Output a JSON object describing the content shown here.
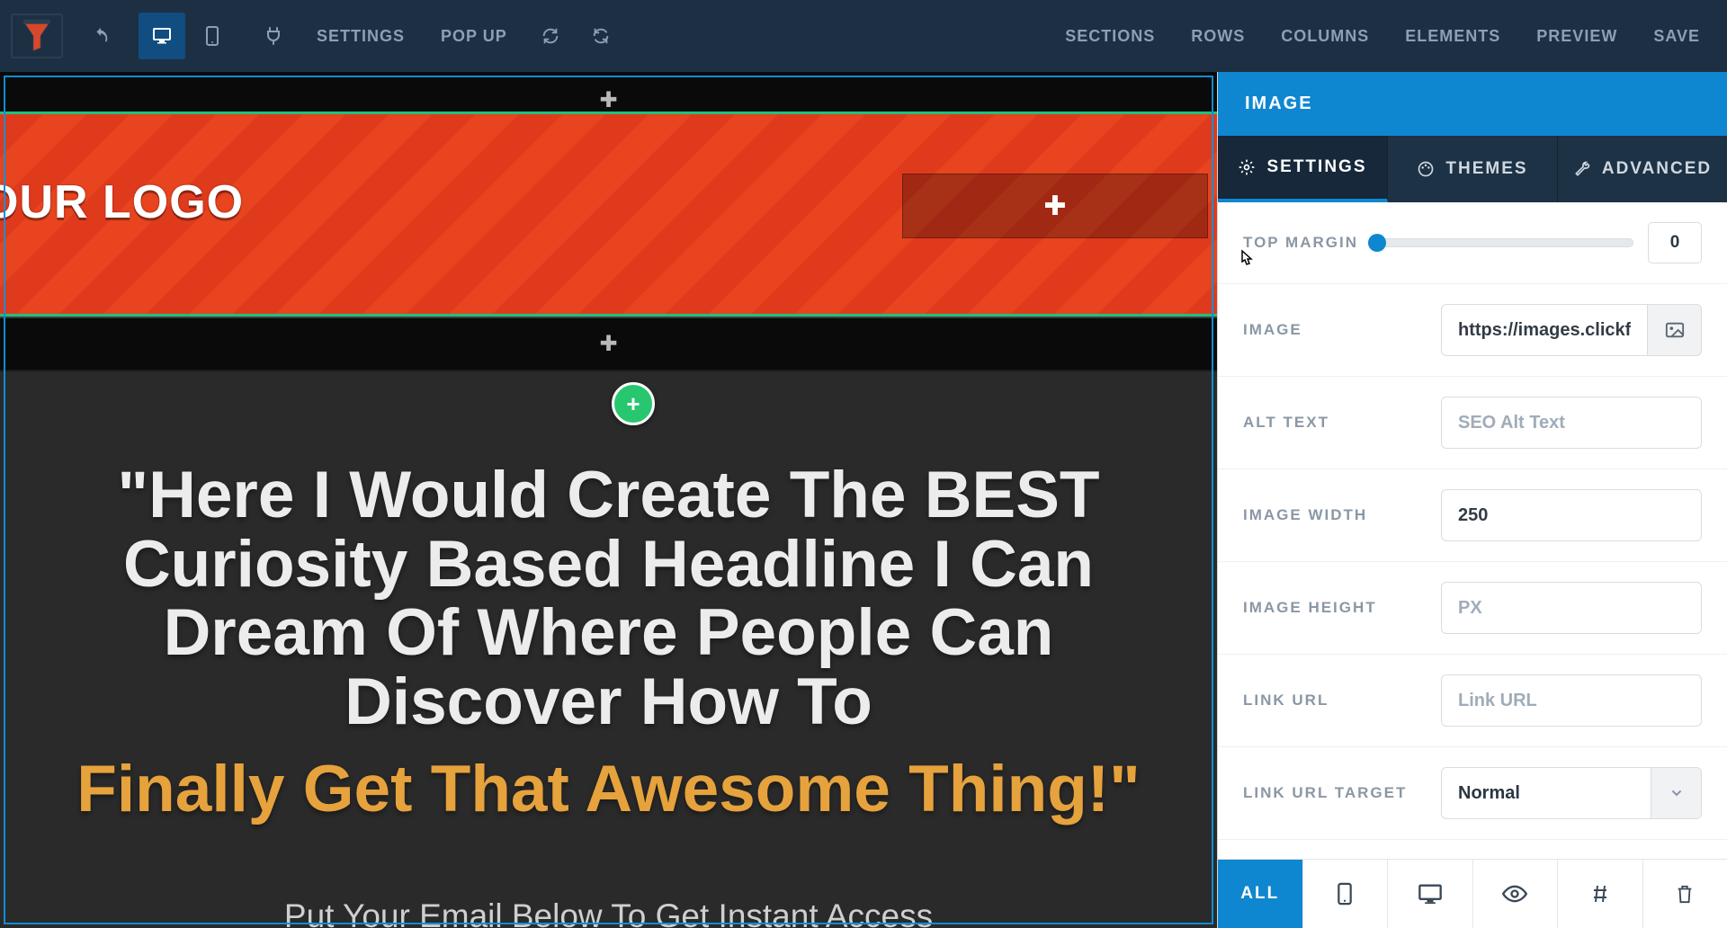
{
  "topbar": {
    "settings": "SETTINGS",
    "popup": "POP UP",
    "right": {
      "sections": "SECTIONS",
      "rows": "ROWS",
      "columns": "COLUMNS",
      "elements": "ELEMENTS",
      "preview": "PREVIEW",
      "save": "SAVE"
    }
  },
  "canvas": {
    "logo_text": "OUR LOGO",
    "headline": "\"Here I Would Create The BEST Curiosity Based Headline I Can Dream Of Where People Can Discover How To",
    "headline2": "Finally Get That Awesome Thing!\"",
    "subline": "Put Your Email Below To Get Instant Access"
  },
  "sidebar": {
    "title": "IMAGE",
    "tabs": {
      "settings": "SETTINGS",
      "themes": "THEMES",
      "advanced": "ADVANCED"
    },
    "fields": {
      "top_margin": {
        "label": "TOP MARGIN",
        "value": "0"
      },
      "image": {
        "label": "IMAGE",
        "value": "https://images.clickfun"
      },
      "alt_text": {
        "label": "ALT TEXT",
        "placeholder": "SEO Alt Text",
        "value": ""
      },
      "image_width": {
        "label": "IMAGE WIDTH",
        "value": "250"
      },
      "image_height": {
        "label": "IMAGE HEIGHT",
        "placeholder": "PX",
        "value": ""
      },
      "link_url": {
        "label": "LINK URL",
        "placeholder": "Link URL",
        "value": ""
      },
      "link_url_target": {
        "label": "LINK URL TARGET",
        "value": "Normal"
      }
    },
    "footer": {
      "all": "ALL"
    }
  }
}
